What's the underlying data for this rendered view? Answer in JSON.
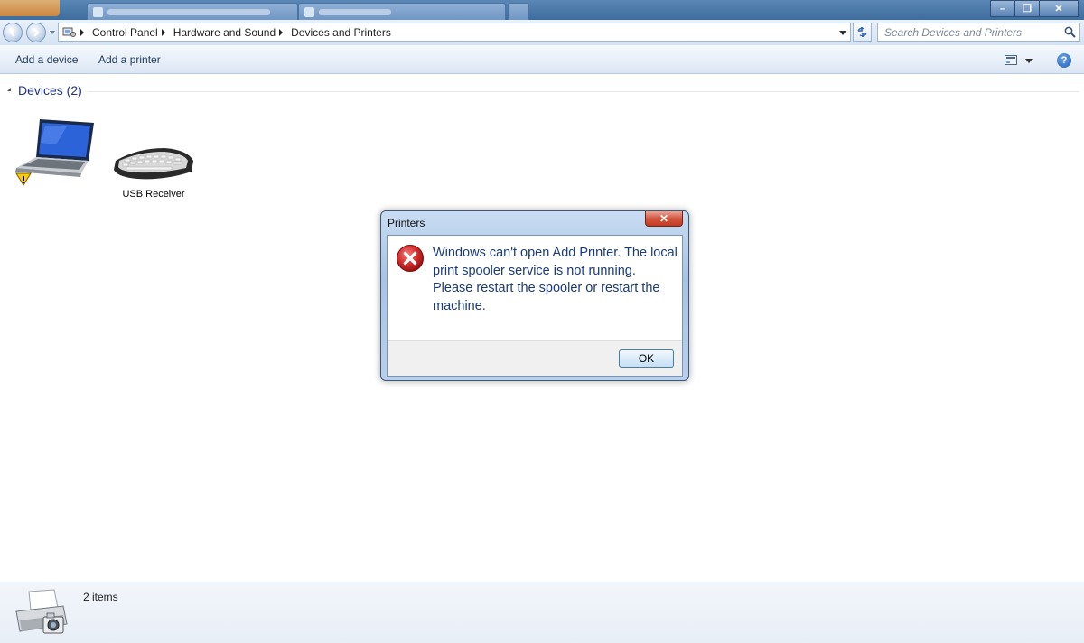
{
  "window": {
    "min_label": "–",
    "max_label": "❐",
    "close_label": "✕"
  },
  "breadcrumbs": [
    "Control Panel",
    "Hardware and Sound",
    "Devices and Printers"
  ],
  "search": {
    "placeholder": "Search Devices and Printers"
  },
  "commands": {
    "add_device": "Add a device",
    "add_printer": "Add a printer",
    "help": "?"
  },
  "group": {
    "header": "Devices (2)"
  },
  "devices": [
    {
      "label": "",
      "icon": "laptop-warning-icon"
    },
    {
      "label": "USB Receiver",
      "icon": "keyboard-icon"
    }
  ],
  "dialog": {
    "title": "Printers",
    "close_label": "✕",
    "message": "Windows can't open Add Printer. The local print spooler service is not running. Please restart the spooler or restart the machine.",
    "ok_label": "OK",
    "icon": "error-icon"
  },
  "details": {
    "count_text": "2 items",
    "icon": "printer-icon"
  },
  "colors": {
    "accent": "#1e3287",
    "dialog_text": "#1a3a78",
    "error": "#c8202a"
  }
}
